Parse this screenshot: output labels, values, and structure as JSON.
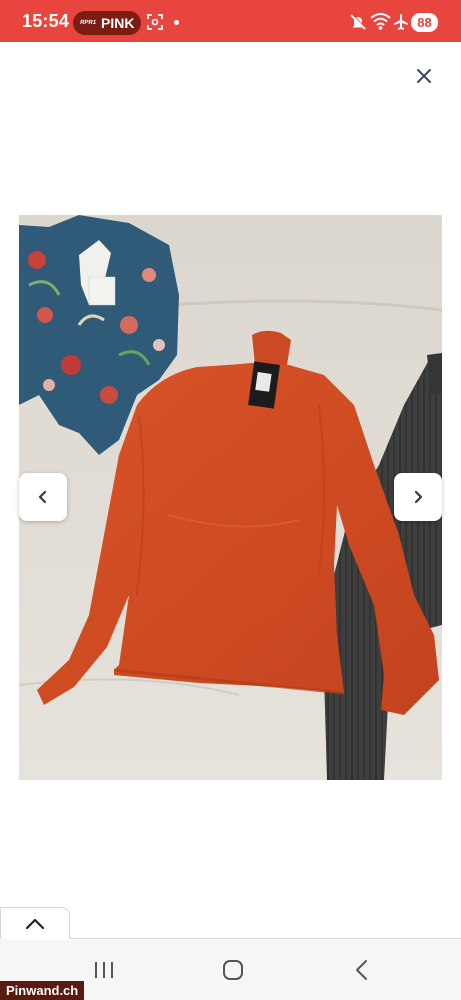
{
  "status_bar": {
    "time": "15:54",
    "radio_logo": "RPR1",
    "radio_name": "PINK",
    "battery": "88",
    "color": "#e9453f"
  },
  "viewer": {
    "close_icon": "close-icon",
    "prev_icon": "chevron-left-icon",
    "next_icon": "chevron-right-icon",
    "photo_subject": "orange turtleneck long-sleeve top"
  },
  "bottom": {
    "collapse_icon": "chevron-up-icon"
  },
  "watermark": "Pinwand.ch"
}
